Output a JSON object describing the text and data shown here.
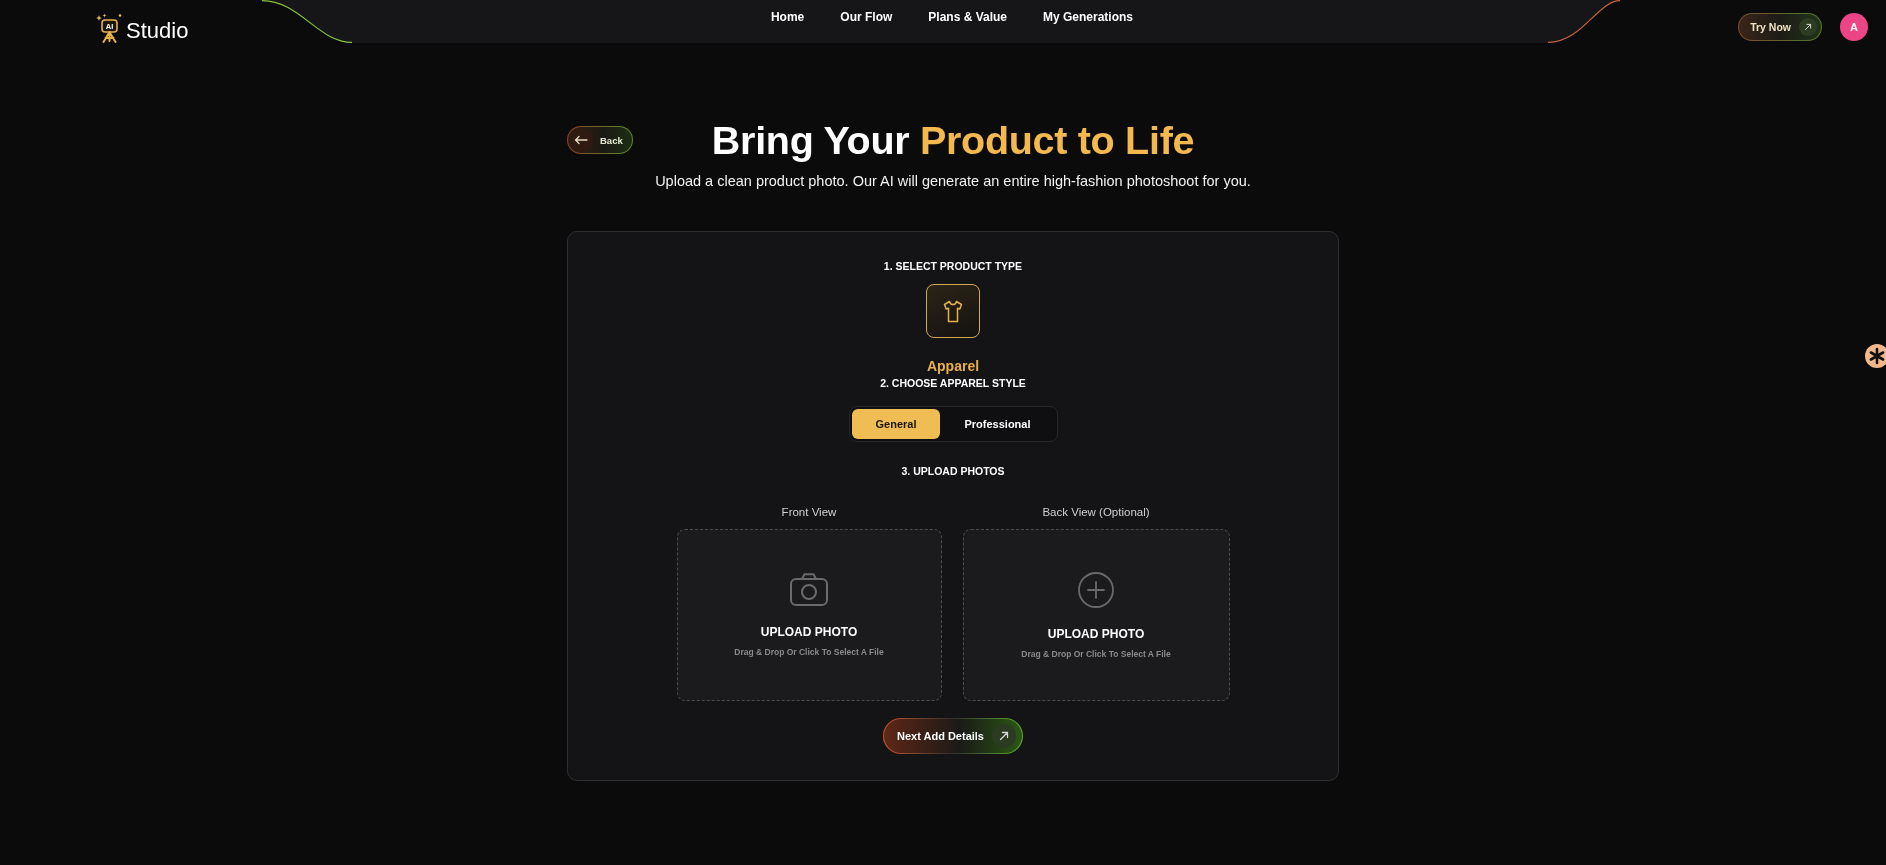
{
  "header": {
    "logo": {
      "badge": "AI",
      "name": "Studio"
    },
    "nav": [
      {
        "label": "Home"
      },
      {
        "label": "Our Flow"
      },
      {
        "label": "Plans & Value"
      },
      {
        "label": "My Generations"
      }
    ],
    "try_now": {
      "label": "Try Now"
    },
    "avatar": {
      "initial": "A"
    }
  },
  "hero": {
    "back": {
      "label": "Back"
    },
    "title": {
      "lead": "Bring Your",
      "highlight": "Product to Life"
    },
    "subtitle": "Upload a clean product photo. Our AI will generate an entire high-fashion photoshoot for you."
  },
  "card": {
    "product_type": {
      "heading": "1. SELECT PRODUCT TYPE",
      "options": [
        {
          "label": "Apparel",
          "kind": "shirt",
          "selected": true
        }
      ]
    },
    "apparel_style": {
      "heading": "2. CHOOSE APPAREL STYLE",
      "options": [
        {
          "label": "General",
          "selected": true
        },
        {
          "label": "Professional",
          "selected": false
        }
      ]
    },
    "upload": {
      "heading": "3. UPLOAD PHOTOS",
      "slots": [
        {
          "label": "Front View",
          "kind": "camera",
          "title": "UPLOAD PHOTO",
          "hint": "Drag & Drop Or Click To Select A File"
        },
        {
          "label": "Back View (Optional)",
          "kind": "plus",
          "title": "UPLOAD PHOTO",
          "hint": "Drag & Drop Or Click To Select A File"
        }
      ]
    },
    "next": {
      "label": "Next Add Details"
    }
  }
}
